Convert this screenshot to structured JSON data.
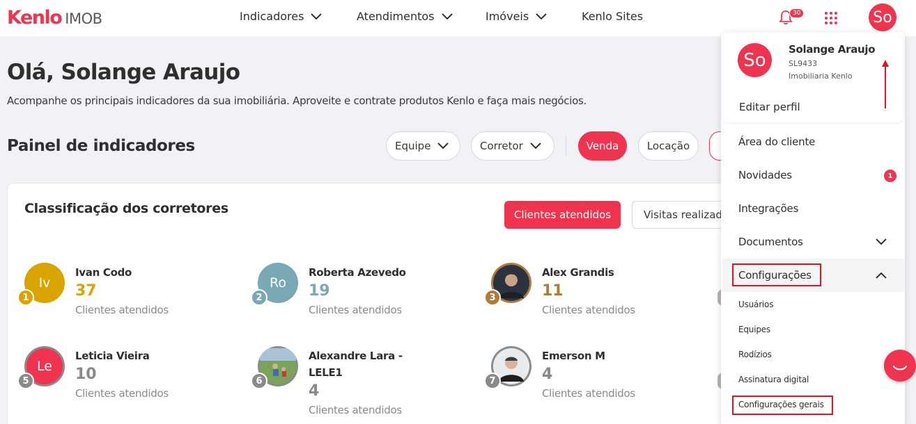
{
  "header": {
    "logo_brand": "Kenlo",
    "logo_sub": "IMOB",
    "nav": [
      {
        "label": "Indicadores"
      },
      {
        "label": "Atendimentos"
      },
      {
        "label": "Imóveis"
      },
      {
        "label": "Kenlo Sites"
      }
    ],
    "notifications_count": "30",
    "avatar_initials": "So"
  },
  "greeting": {
    "title": "Olá, Solange Araujo",
    "subtitle": "Acompanhe os principais indicadores da sua imobiliária. Aproveite e contrate produtos Kenlo e faça mais negócios."
  },
  "panel": {
    "title": "Painel de indicadores",
    "filters": {
      "equipe": "Equipe",
      "corretor": "Corretor"
    },
    "toggles": {
      "venda": "Venda",
      "locacao": "Locação"
    }
  },
  "ranking": {
    "title": "Classificação dos corretores",
    "buttons": {
      "clientes": "Clientes atendidos",
      "visitas": "Visitas realizadas"
    },
    "items": [
      {
        "rank": "1",
        "initials": "Iv",
        "name": "Ivan Codo",
        "value": "37",
        "label": "Clientes atendidos",
        "color": "#d9a300",
        "value_color": "#d9a300"
      },
      {
        "rank": "2",
        "initials": "Ro",
        "name": "Roberta Azevedo",
        "value": "19",
        "label": "Clientes atendidos",
        "color": "#7aa8b4",
        "value_color": "#7aa8b4"
      },
      {
        "rank": "3",
        "initials": "",
        "name": "Alex Grandis",
        "value": "11",
        "label": "Clientes atendidos",
        "color": "#b07a3a",
        "value_color": "#b07a3a"
      },
      {
        "rank": "5",
        "initials": "Le",
        "name": "Leticia Vieira",
        "value": "10",
        "label": "Clientes atendidos",
        "color": "#f0334e",
        "value_color": "#8a8a8a"
      },
      {
        "rank": "6",
        "initials": "",
        "name": "Alexandre Lara - LELE1",
        "value": "4",
        "label": "Clientes atendidos",
        "color": "#6d8f4e",
        "value_color": "#8a8a8a"
      },
      {
        "rank": "7",
        "initials": "",
        "name": "Emerson M",
        "value": "4",
        "label": "Clientes atendidos",
        "color": "#9a9a9a",
        "value_color": "#8a8a8a"
      }
    ]
  },
  "menu": {
    "avatar_initials": "So",
    "name": "Solange Araujo",
    "code": "SL9433",
    "company": "Imobiliaria Kenlo",
    "edit_profile": "Editar perfil",
    "items": {
      "area_cliente": "Área do cliente",
      "novidades": "Novidades",
      "novidades_badge": "1",
      "integracoes": "Integrações",
      "documentos": "Documentos",
      "configuracoes": "Configurações"
    },
    "sub_items": {
      "usuarios": "Usuários",
      "equipes": "Equipes",
      "rodizios": "Rodízios",
      "assinatura": "Assinatura digital",
      "config_gerais": "Configurações gerais"
    }
  }
}
